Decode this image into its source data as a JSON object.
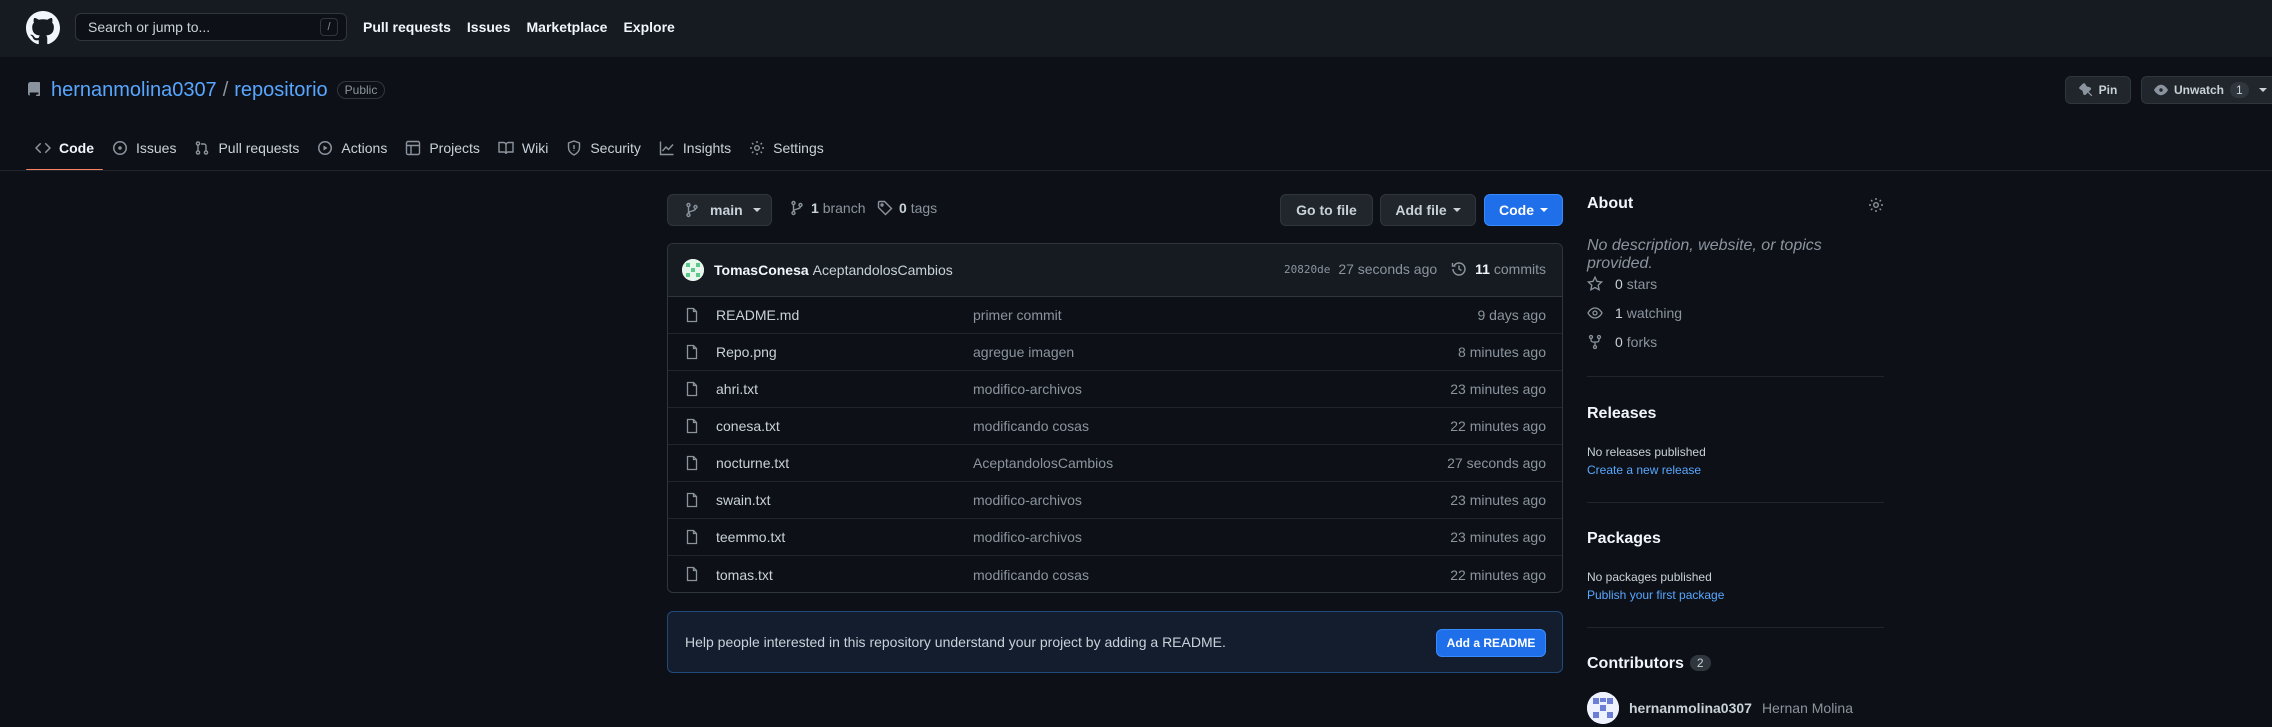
{
  "header": {
    "search_placeholder": "Search or jump to...",
    "search_shortcut": "/",
    "nav": [
      "Pull requests",
      "Issues",
      "Marketplace",
      "Explore"
    ]
  },
  "repo": {
    "owner": "hernanmolina0307",
    "separator": "/",
    "name": "repositorio",
    "visibility": "Public",
    "pin_label": "Pin",
    "unwatch_label": "Unwatch",
    "watch_count": "1"
  },
  "tabs": [
    {
      "label": "Code",
      "icon": "code-icon",
      "active": true
    },
    {
      "label": "Issues",
      "icon": "issue-icon"
    },
    {
      "label": "Pull requests",
      "icon": "pull-request-icon"
    },
    {
      "label": "Actions",
      "icon": "play-icon"
    },
    {
      "label": "Projects",
      "icon": "table-icon"
    },
    {
      "label": "Wiki",
      "icon": "book-icon"
    },
    {
      "label": "Security",
      "icon": "shield-icon"
    },
    {
      "label": "Insights",
      "icon": "graph-icon"
    },
    {
      "label": "Settings",
      "icon": "gear-icon"
    }
  ],
  "filenav": {
    "branch": "main",
    "branch_count": "1",
    "branch_label": "branch",
    "tag_count": "0",
    "tag_label": "tags",
    "go_to_file": "Go to file",
    "add_file": "Add file",
    "code": "Code"
  },
  "latest_commit": {
    "author": "TomasConesa",
    "message": "AceptandolosCambios",
    "sha": "20820de",
    "age": "27 seconds ago",
    "commit_count": "11",
    "commit_label": "commits"
  },
  "files": [
    {
      "name": "README.md",
      "message": "primer commit",
      "age": "9 days ago"
    },
    {
      "name": "Repo.png",
      "message": "agregue imagen",
      "age": "8 minutes ago"
    },
    {
      "name": "ahri.txt",
      "message": "modifico-archivos",
      "age": "23 minutes ago"
    },
    {
      "name": "conesa.txt",
      "message": "modificando cosas",
      "age": "22 minutes ago"
    },
    {
      "name": "nocturne.txt",
      "message": "AceptandolosCambios",
      "age": "27 seconds ago"
    },
    {
      "name": "swain.txt",
      "message": "modifico-archivos",
      "age": "23 minutes ago"
    },
    {
      "name": "teemmo.txt",
      "message": "modifico-archivos",
      "age": "23 minutes ago"
    },
    {
      "name": "tomas.txt",
      "message": "modificando cosas",
      "age": "22 minutes ago"
    }
  ],
  "readme_banner": {
    "text": "Help people interested in this repository understand your project by adding a README.",
    "button": "Add a README"
  },
  "sidebar": {
    "about_title": "About",
    "about_desc": "No description, website, or topics provided.",
    "stars_count": "0",
    "stars_label": "stars",
    "watching_count": "1",
    "watching_label": "watching",
    "forks_count": "0",
    "forks_label": "forks",
    "releases_title": "Releases",
    "releases_empty": "No releases published",
    "releases_link": "Create a new release",
    "packages_title": "Packages",
    "packages_empty": "No packages published",
    "packages_link": "Publish your first package",
    "contributors_title": "Contributors",
    "contributors_count": "2",
    "contributor_login": "hernanmolina0307",
    "contributor_name": "Hernan Molina"
  },
  "colors": {
    "accent_blue": "#58a6ff",
    "primary_button": "#1f6feb",
    "active_tab_underline": "#f78166",
    "background": "#0d1117",
    "header_background": "#161b22"
  }
}
